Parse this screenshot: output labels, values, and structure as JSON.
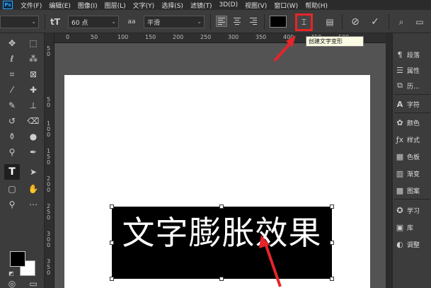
{
  "app": {
    "logo": "Ps"
  },
  "menu": [
    "文件(F)",
    "编辑(E)",
    "图像(I)",
    "图层(L)",
    "文字(Y)",
    "选择(S)",
    "滤镜(T)",
    "3D(D)",
    "视图(V)",
    "窗口(W)",
    "帮助(H)"
  ],
  "options_bar": {
    "font_size": "60 点",
    "anti_alias": "平滑",
    "anti_alias_icon_label": "aa",
    "text_color": "#000000",
    "warp_tooltip": "创建文字变形"
  },
  "canvas": {
    "text": "文字膨胀效果",
    "ruler_top": [
      "50",
      "0",
      "50",
      "100",
      "150",
      "200",
      "250",
      "300",
      "350",
      "400",
      "450",
      "500"
    ],
    "ruler_left": [
      "5\n0",
      "5\n0",
      "1\n0\n0",
      "1\n5\n0",
      "2\n0\n0",
      "2\n5\n0",
      "3\n0\n0",
      "3\n5\n0"
    ]
  },
  "panels": [
    {
      "label": "段落",
      "icon": "paragraph-icon"
    },
    {
      "label": "属性",
      "icon": "properties-icon"
    },
    {
      "label": "历...",
      "icon": "history-icon"
    },
    {
      "label": "字符",
      "icon": "character-icon"
    },
    {
      "label": "颜色",
      "icon": "color-icon"
    },
    {
      "label": "样式",
      "icon": "styles-icon"
    },
    {
      "label": "色板",
      "icon": "swatches-icon"
    },
    {
      "label": "渐变",
      "icon": "gradient-icon"
    },
    {
      "label": "图案",
      "icon": "patterns-icon"
    },
    {
      "label": "学习",
      "icon": "learn-icon"
    },
    {
      "label": "库",
      "icon": "libraries-icon"
    },
    {
      "label": "调整",
      "icon": "adjustments-icon"
    }
  ],
  "colors": {
    "accent": "#e5252a",
    "foreground": "#000000",
    "background": "#ffffff"
  }
}
